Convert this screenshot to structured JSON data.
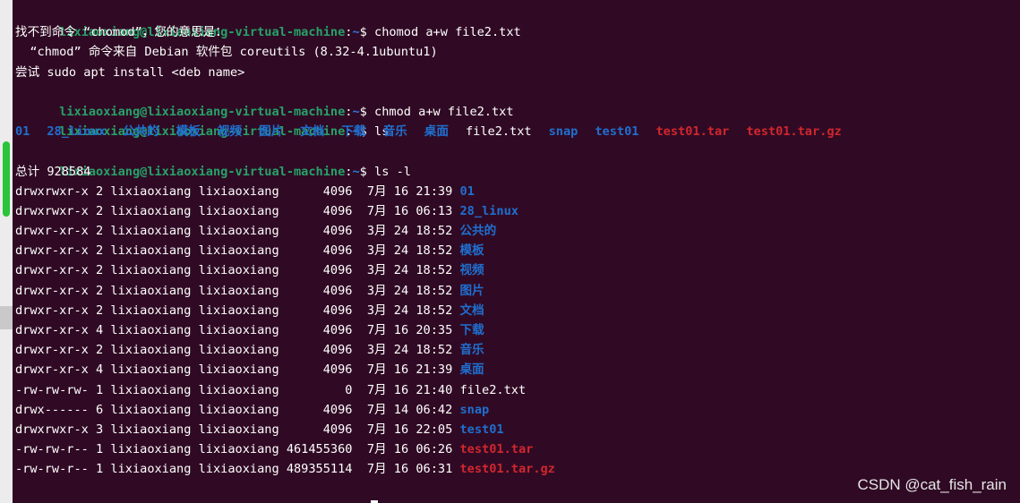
{
  "prompt": {
    "user_host": "lixiaoxiang@lixiaoxiang-virtual-machine",
    "separator": ":",
    "path": "~",
    "sign": "$"
  },
  "output": {
    "cmd1": "chomod a+w file2.txt",
    "not_found_1": "找不到命令 “chomod”，您的意思是：",
    "not_found_2": "  “chmod” 命令来自 Debian 软件包 coreutils (8.32-4.1ubuntu1)",
    "not_found_3": "尝试 sudo apt install <deb name>",
    "cmd2": "chmod a+w file2.txt",
    "cmd3": "ls",
    "ls_items": [
      {
        "name": "01",
        "kind": "dir"
      },
      {
        "name": "28_linux",
        "kind": "dir"
      },
      {
        "name": "公共的",
        "kind": "dir"
      },
      {
        "name": "模板",
        "kind": "dir"
      },
      {
        "name": "视频",
        "kind": "dir"
      },
      {
        "name": "图片",
        "kind": "dir"
      },
      {
        "name": "文档",
        "kind": "dir"
      },
      {
        "name": "下载",
        "kind": "dir"
      },
      {
        "name": "音乐",
        "kind": "dir"
      },
      {
        "name": "桌面",
        "kind": "dir"
      },
      {
        "name": "file2.txt",
        "kind": "file"
      },
      {
        "name": "snap",
        "kind": "dir"
      },
      {
        "name": "test01",
        "kind": "dir"
      },
      {
        "name": "test01.tar",
        "kind": "archive"
      },
      {
        "name": "test01.tar.gz",
        "kind": "archive"
      }
    ],
    "cmd4": "ls -l",
    "total": "总计 928584",
    "long_rows": [
      {
        "meta": "drwxrwxr-x 2 lixiaoxiang lixiaoxiang      4096  7月 16 21:39 ",
        "name": "01",
        "kind": "dir"
      },
      {
        "meta": "drwxrwxr-x 2 lixiaoxiang lixiaoxiang      4096  7月 16 06:13 ",
        "name": "28_linux",
        "kind": "dir"
      },
      {
        "meta": "drwxr-xr-x 2 lixiaoxiang lixiaoxiang      4096  3月 24 18:52 ",
        "name": "公共的",
        "kind": "dir"
      },
      {
        "meta": "drwxr-xr-x 2 lixiaoxiang lixiaoxiang      4096  3月 24 18:52 ",
        "name": "模板",
        "kind": "dir"
      },
      {
        "meta": "drwxr-xr-x 2 lixiaoxiang lixiaoxiang      4096  3月 24 18:52 ",
        "name": "视频",
        "kind": "dir"
      },
      {
        "meta": "drwxr-xr-x 2 lixiaoxiang lixiaoxiang      4096  3月 24 18:52 ",
        "name": "图片",
        "kind": "dir"
      },
      {
        "meta": "drwxr-xr-x 2 lixiaoxiang lixiaoxiang      4096  3月 24 18:52 ",
        "name": "文档",
        "kind": "dir"
      },
      {
        "meta": "drwxr-xr-x 4 lixiaoxiang lixiaoxiang      4096  7月 16 20:35 ",
        "name": "下载",
        "kind": "dir"
      },
      {
        "meta": "drwxr-xr-x 2 lixiaoxiang lixiaoxiang      4096  3月 24 18:52 ",
        "name": "音乐",
        "kind": "dir"
      },
      {
        "meta": "drwxr-xr-x 4 lixiaoxiang lixiaoxiang      4096  7月 16 21:39 ",
        "name": "桌面",
        "kind": "dir"
      },
      {
        "meta": "-rw-rw-rw- 1 lixiaoxiang lixiaoxiang         0  7月 16 21:40 ",
        "name": "file2.txt",
        "kind": "file"
      },
      {
        "meta": "drwx------ 6 lixiaoxiang lixiaoxiang      4096  7月 14 06:42 ",
        "name": "snap",
        "kind": "dir"
      },
      {
        "meta": "drwxrwxr-x 3 lixiaoxiang lixiaoxiang      4096  7月 16 22:05 ",
        "name": "test01",
        "kind": "dir"
      },
      {
        "meta": "-rw-rw-r-- 1 lixiaoxiang lixiaoxiang 461455360  7月 16 06:26 ",
        "name": "test01.tar",
        "kind": "archive"
      },
      {
        "meta": "-rw-rw-r-- 1 lixiaoxiang lixiaoxiang 489355114  7月 16 06:31 ",
        "name": "test01.tar.gz",
        "kind": "archive"
      }
    ]
  },
  "watermark": "CSDN @cat_fish_rain",
  "colors": {
    "background": "#300a24",
    "prompt_user": "#26a269",
    "prompt_path": "#2a7bde",
    "directory": "#1f6fd0",
    "archive": "#d1262e",
    "scrollbar_thumb": "#29c439"
  }
}
